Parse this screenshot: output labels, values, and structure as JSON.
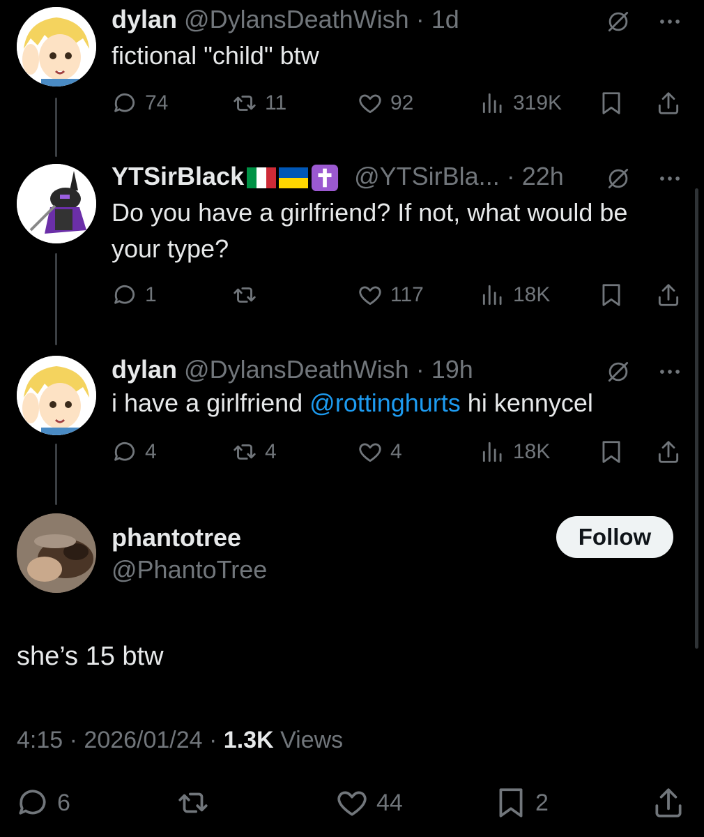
{
  "colors": {
    "background": "#000000",
    "text": "#e7e9ea",
    "muted": "#71767b",
    "link": "#1d9bf0",
    "follow_bg": "#eff3f4"
  },
  "tweets": [
    {
      "name": "dylan",
      "handle": "@DylansDeathWish",
      "time": "1d",
      "text": "fictional \"child\" btw",
      "replies": "74",
      "reposts": "11",
      "likes": "92",
      "views": "319K"
    },
    {
      "name": "YTSirBlack",
      "flags": [
        "italy-flag",
        "ukraine-flag",
        "latin-cross"
      ],
      "handle": "@YTSirBla...",
      "time": "22h",
      "text": "Do you have a girlfriend? If not, what would be your type?",
      "replies": "1",
      "reposts": "",
      "likes": "117",
      "views": "18K"
    },
    {
      "name": "dylan",
      "handle": "@DylansDeathWish",
      "time": "19h",
      "text_before": "i have a girlfriend ",
      "mention": "@rottinghurts",
      "text_after": " hi kennycel",
      "replies": "4",
      "reposts": "4",
      "likes": "4",
      "views": "18K"
    }
  ],
  "main": {
    "name": "phantotree",
    "handle": "@PhantoTree",
    "follow_label": "Follow",
    "text": "she’s 15 btw",
    "time": "4:15",
    "date": "2026/01/24",
    "views_count": "1.3K",
    "views_label": "Views",
    "replies": "6",
    "reposts": "",
    "likes": "44",
    "bookmarks": "2"
  }
}
